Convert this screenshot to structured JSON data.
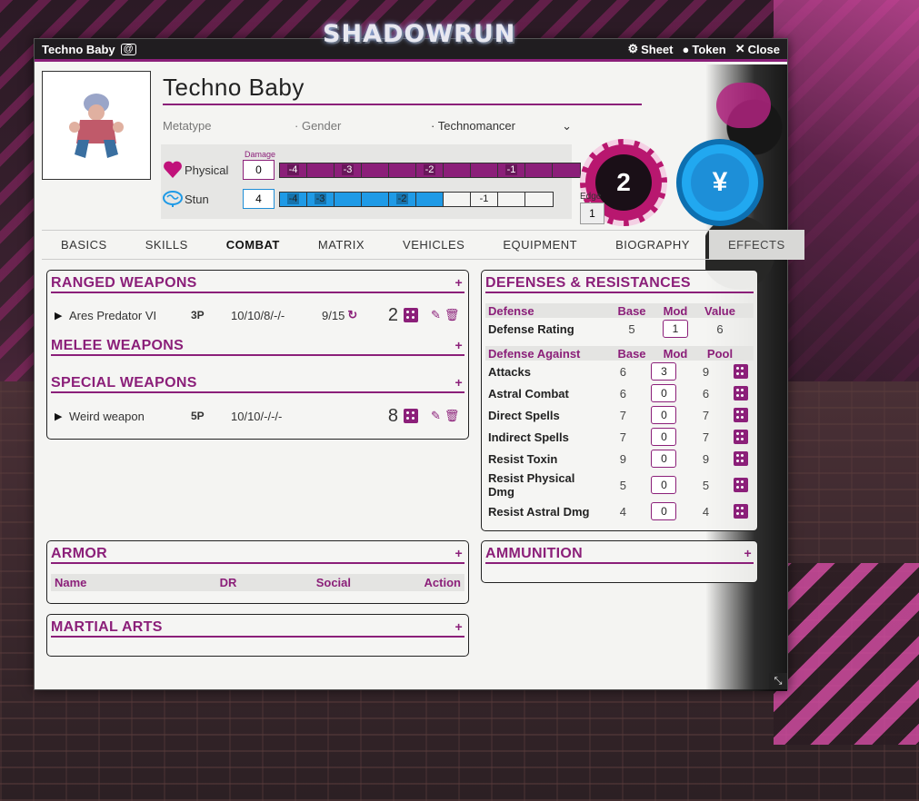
{
  "app": {
    "logo": "SHADOWRUN"
  },
  "titlebar": {
    "title": "Techno Baby",
    "sheet_label": "Sheet",
    "token_label": "Token",
    "close_label": "Close"
  },
  "character": {
    "name": "Techno Baby",
    "metatype_placeholder": "Metatype",
    "gender_placeholder": "Gender",
    "type": "Technomancer"
  },
  "condition": {
    "damage_header": "Damage",
    "physical": {
      "label": "Physical",
      "damage": "0",
      "cells": [
        "-4",
        "",
        "-3",
        "",
        "",
        "-2",
        "",
        "",
        "-1",
        "",
        ""
      ]
    },
    "stun": {
      "label": "Stun",
      "damage": "4",
      "cells": [
        "-4",
        "-3",
        "",
        "",
        "-2",
        "",
        "",
        "-1",
        "",
        ""
      ],
      "filled_count": 6
    }
  },
  "edge": {
    "label": "Edge",
    "current": "2",
    "max": "1"
  },
  "nuyen": {
    "symbol": "¥"
  },
  "tabs": [
    "BASICS",
    "SKILLS",
    "COMBAT",
    "MATRIX",
    "VEHICLES",
    "EQUIPMENT",
    "BIOGRAPHY",
    "EFFECTS"
  ],
  "active_tab": "COMBAT",
  "ranged": {
    "title": "RANGED WEAPONS",
    "add": "+",
    "items": [
      {
        "name": "Ares Predator VI",
        "dv": "3P",
        "ar": "10/10/8/-/-",
        "ammo": "9/15",
        "pool": "2"
      }
    ]
  },
  "melee": {
    "title": "MELEE WEAPONS",
    "add": "+"
  },
  "special": {
    "title": "SPECIAL WEAPONS",
    "add": "+",
    "items": [
      {
        "name": "Weird weapon",
        "dv": "5P",
        "ar": "10/10/-/-/-",
        "pool": "8"
      }
    ]
  },
  "armor": {
    "title": "ARMOR",
    "add": "+",
    "columns": [
      "Name",
      "DR",
      "Social",
      "Action"
    ]
  },
  "martial": {
    "title": "MARTIAL ARTS",
    "add": "+"
  },
  "defenses": {
    "title": "DEFENSES & RESISTANCES",
    "head1": [
      "Defense",
      "Base",
      "Mod",
      "Value"
    ],
    "rating": {
      "name": "Defense Rating",
      "base": "5",
      "mod": "1",
      "value": "6"
    },
    "head2": [
      "Defense Against",
      "Base",
      "Mod",
      "Pool"
    ],
    "rows": [
      {
        "name": "Attacks",
        "base": "6",
        "mod": "3",
        "pool": "9"
      },
      {
        "name": "Astral Combat",
        "base": "6",
        "mod": "0",
        "pool": "6"
      },
      {
        "name": "Direct Spells",
        "base": "7",
        "mod": "0",
        "pool": "7"
      },
      {
        "name": "Indirect Spells",
        "base": "7",
        "mod": "0",
        "pool": "7"
      },
      {
        "name": "Resist Toxin",
        "base": "9",
        "mod": "0",
        "pool": "9"
      },
      {
        "name": "Resist Physical Dmg",
        "base": "5",
        "mod": "0",
        "pool": "5"
      },
      {
        "name": "Resist Astral Dmg",
        "base": "4",
        "mod": "0",
        "pool": "4"
      }
    ]
  },
  "ammunition": {
    "title": "AMMUNITION",
    "add": "+"
  },
  "colors": {
    "accent": "#8b1f79",
    "stun": "#1f9ae6",
    "edge": "#b8176f"
  }
}
